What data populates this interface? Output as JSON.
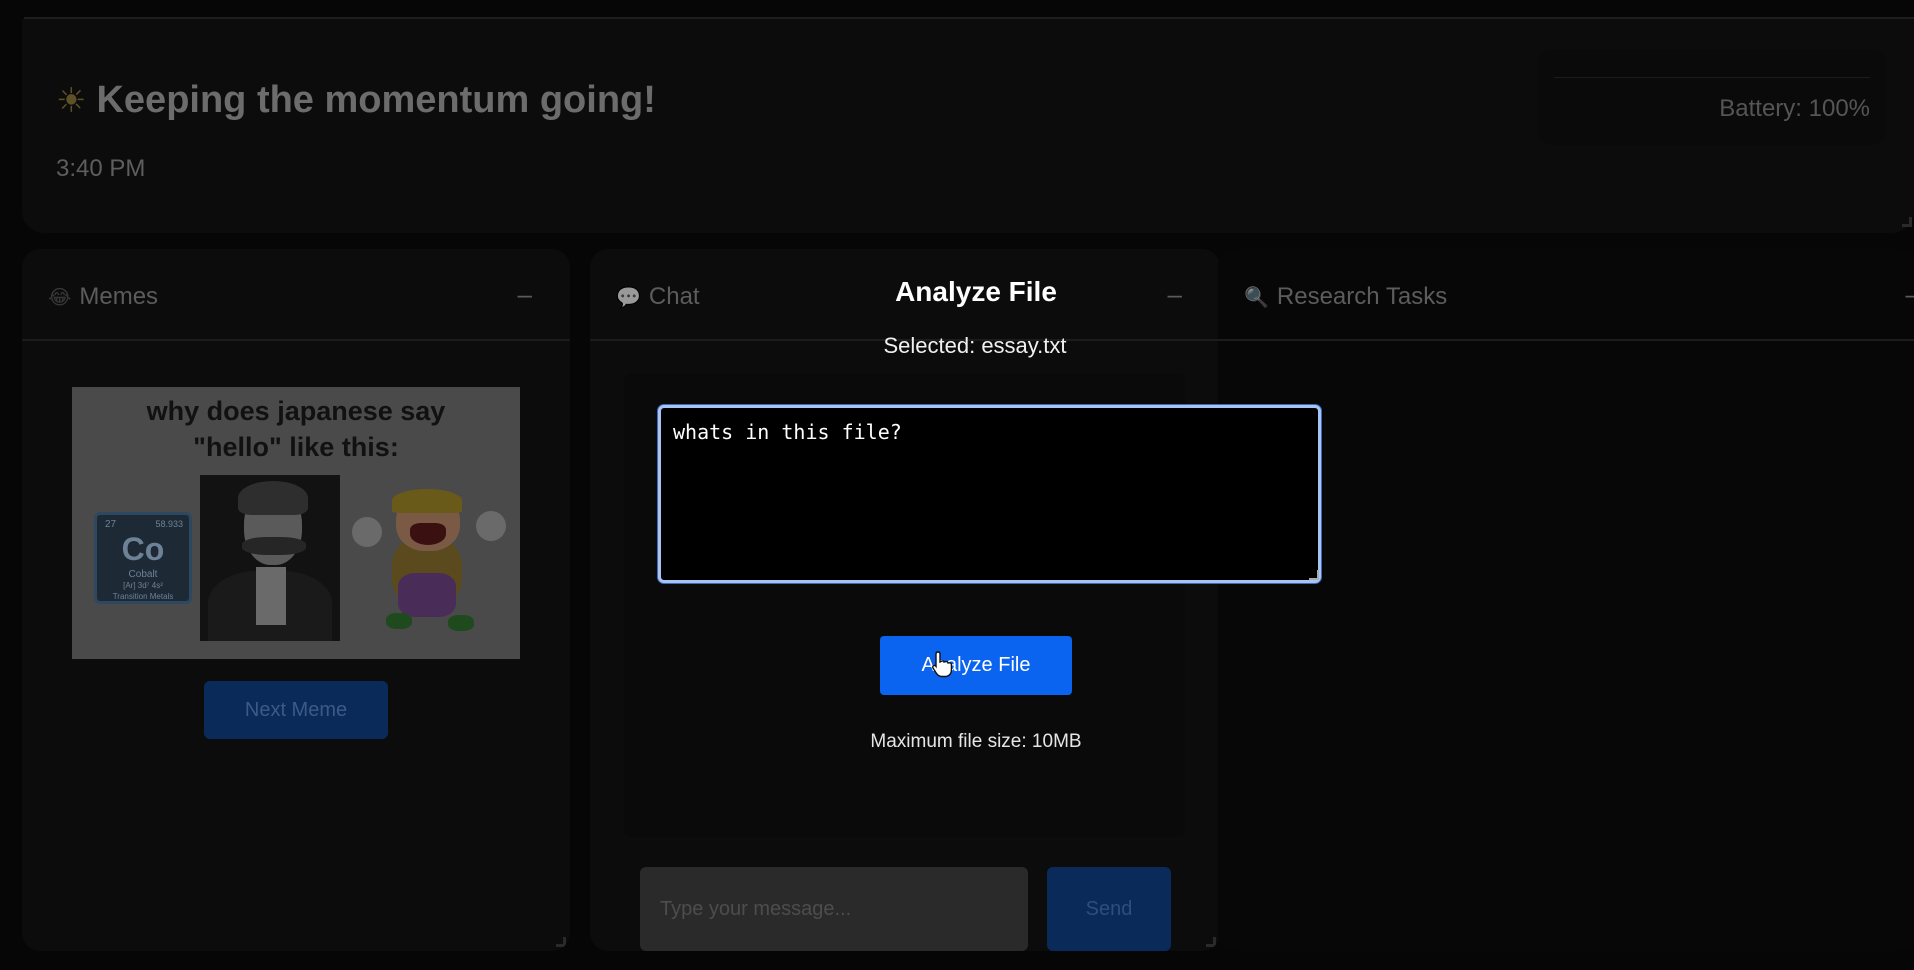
{
  "header": {
    "greeting": "Keeping the momentum going!",
    "greeting_icon": "sun-icon",
    "time": "3:40 PM",
    "battery": "Battery: 100%"
  },
  "panels": {
    "memes": {
      "title": "Memes",
      "icon": "laughing-face-icon",
      "minimize_label": "–",
      "meme": {
        "caption_line1": "why does japanese say",
        "caption_line2": "\"hello\" like this:",
        "element_number": "27",
        "element_mass": "58.933",
        "element_symbol": "Co",
        "element_name": "Cobalt",
        "element_config": "[Ar] 3d⁷ 4s²",
        "element_class": "Transition Metals"
      },
      "next_button": "Next Meme"
    },
    "chat": {
      "title": "Chat",
      "icon": "speech-bubble-icon",
      "minimize_label": "–",
      "input_placeholder": "Type your message...",
      "send_button": "Send"
    },
    "research": {
      "title": "Research Tasks",
      "icon": "magnifier-icon",
      "minimize_label": "–"
    }
  },
  "analyze_dialog": {
    "title": "Analyze File",
    "selected": "Selected: essay.txt",
    "prompt_value": "whats in this file?",
    "analyze_button": "Analyze File",
    "max_size_note": "Maximum file size: 10MB"
  },
  "colors": {
    "accent": "#0a64f0",
    "dimmed_accent": "#0a2a5a",
    "focus_ring": "#a8c4f0"
  }
}
